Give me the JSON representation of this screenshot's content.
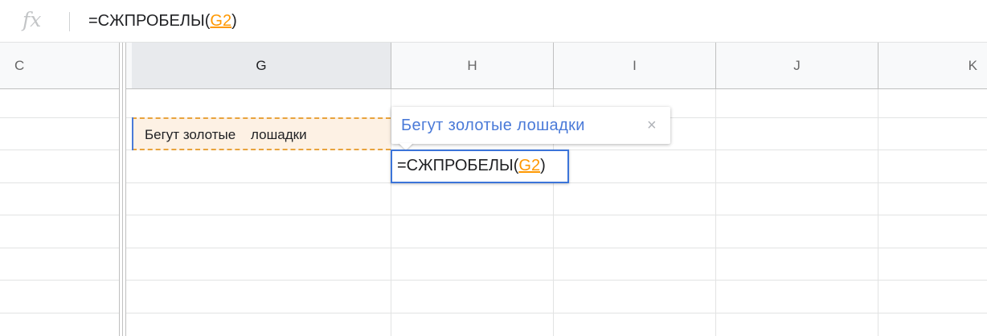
{
  "formula_bar": {
    "fx_label": "fx",
    "formula_prefix": "=СЖПРОБЕЛЫ(",
    "formula_ref": "G2",
    "formula_suffix": ")"
  },
  "columns": [
    "C",
    "G",
    "H",
    "I",
    "J",
    "K"
  ],
  "selected_column": "G",
  "cells": {
    "g2_value": "Бегут золотые    лошадки"
  },
  "preview_tooltip": {
    "text": "Бегут золотые лошадки",
    "close_glyph": "×"
  },
  "edit_cell": {
    "formula_prefix": "=СЖПРОБЕЛЫ(",
    "formula_ref": "G2",
    "formula_suffix": ")"
  },
  "colors": {
    "reference": "#ff9800",
    "selection_blue": "#3b74d9",
    "preview_text": "#4a7ad8",
    "source_fill": "#fdf1e4"
  }
}
